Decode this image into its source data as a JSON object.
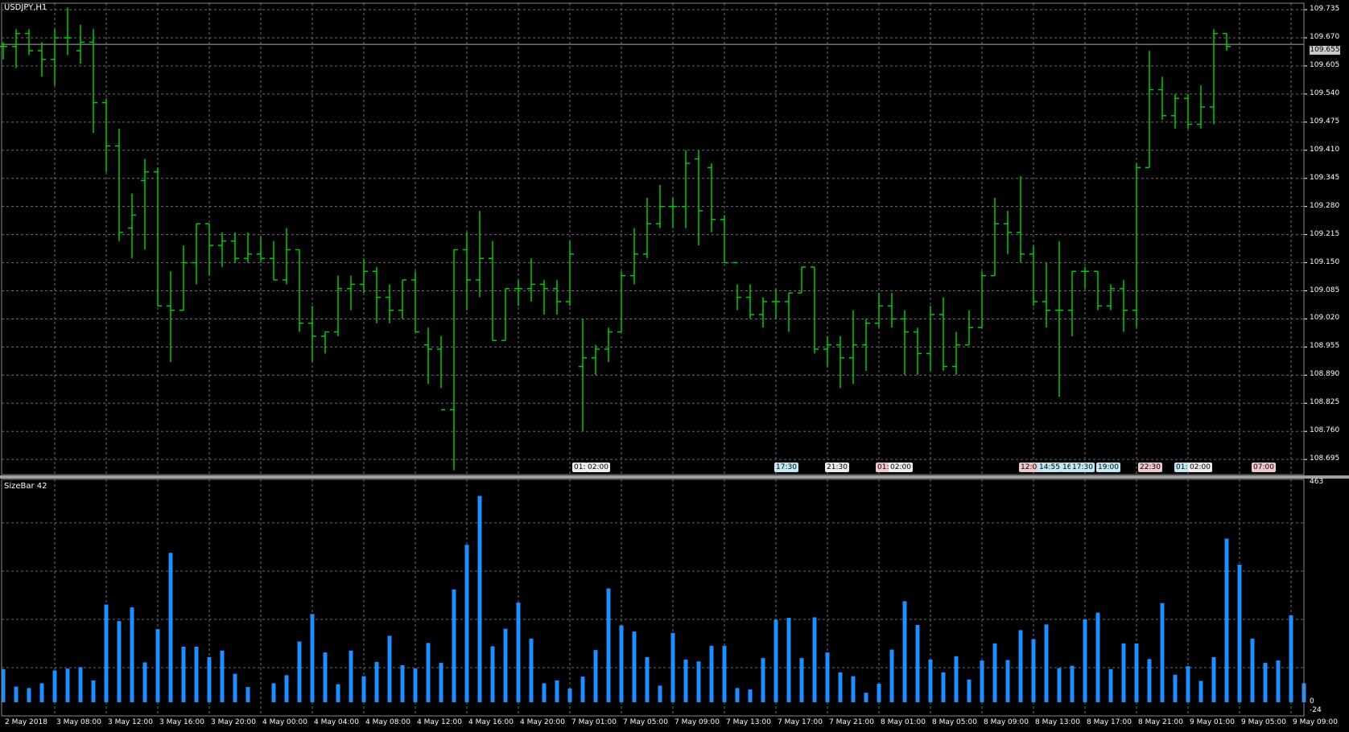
{
  "main_title": "USDJPY,H1",
  "sub_title": "SizeBar 42",
  "current_price": "109.655",
  "colors": {
    "background": "#000000",
    "grid": "#6b6b6b",
    "bars": "#00cc00",
    "histogram": "#1e8fff",
    "separator": "#a0a0a0"
  },
  "price_axis": [
    "109.735",
    "109.670",
    "109.605",
    "109.540",
    "109.475",
    "109.410",
    "109.345",
    "109.280",
    "109.215",
    "109.150",
    "109.085",
    "109.020",
    "108.955",
    "108.890",
    "108.825",
    "108.760",
    "108.695"
  ],
  "sub_axis": {
    "top": "463",
    "zero": "0",
    "bottom": "-24"
  },
  "time_labels": [
    "2 May 2018",
    "3 May 08:00",
    "3 May 12:00",
    "3 May 16:00",
    "3 May 20:00",
    "4 May 00:00",
    "4 May 04:00",
    "4 May 08:00",
    "4 May 12:00",
    "4 May 16:00",
    "4 May 20:00",
    "7 May 01:00",
    "7 May 05:00",
    "7 May 09:00",
    "7 May 13:00",
    "7 May 17:00",
    "7 May 21:00",
    "8 May 01:00",
    "8 May 05:00",
    "8 May 09:00",
    "8 May 13:00",
    "8 May 17:00",
    "8 May 21:00",
    "9 May 01:00",
    "9 May 05:00",
    "9 May 09:00"
  ],
  "events": [
    {
      "text": "01:",
      "color": "w"
    },
    {
      "text": "02:00",
      "color": "w"
    },
    {
      "text": "17:30",
      "color": "c"
    },
    {
      "text": "21:30",
      "color": "w"
    },
    {
      "text": "01:",
      "color": "r"
    },
    {
      "text": "02:00",
      "color": "w"
    },
    {
      "text": "12:00",
      "color": "r"
    },
    {
      "text": "14:55",
      "color": "c"
    },
    {
      "text": "16:",
      "color": "c"
    },
    {
      "text": "17:30",
      "color": "c"
    },
    {
      "text": "19:00",
      "color": "c"
    },
    {
      "text": "22:30",
      "color": "r"
    },
    {
      "text": "01:",
      "color": "c"
    },
    {
      "text": "02:00",
      "color": "w"
    },
    {
      "text": "07:00",
      "color": "r"
    }
  ],
  "chart_data": {
    "type": "ohlc",
    "symbol": "USDJPY",
    "timeframe": "H1",
    "ylim": [
      108.66,
      109.75
    ],
    "ohlc": [
      [
        109.65,
        109.66,
        109.62,
        109.65
      ],
      [
        109.65,
        109.69,
        109.6,
        109.68
      ],
      [
        109.68,
        109.69,
        109.63,
        109.64
      ],
      [
        109.64,
        109.66,
        109.58,
        109.62
      ],
      [
        109.62,
        109.69,
        109.56,
        109.67
      ],
      [
        109.67,
        109.74,
        109.63,
        109.67
      ],
      [
        109.64,
        109.7,
        109.61,
        109.66
      ],
      [
        109.66,
        109.69,
        109.45,
        109.52
      ],
      [
        109.52,
        109.53,
        109.36,
        109.42
      ],
      [
        109.42,
        109.46,
        109.2,
        109.22
      ],
      [
        109.23,
        109.31,
        109.16,
        109.26
      ],
      [
        109.34,
        109.39,
        109.18,
        109.36
      ],
      [
        109.36,
        109.37,
        109.05,
        109.05
      ],
      [
        109.05,
        109.13,
        108.92,
        109.04
      ],
      [
        109.04,
        109.19,
        109.04,
        109.15
      ],
      [
        109.15,
        109.24,
        109.1,
        109.24
      ],
      [
        109.24,
        109.24,
        109.12,
        109.19
      ],
      [
        109.19,
        109.22,
        109.14,
        109.2
      ],
      [
        109.2,
        109.22,
        109.15,
        109.16
      ],
      [
        109.16,
        109.22,
        109.15,
        109.17
      ],
      [
        109.17,
        109.21,
        109.15,
        109.16
      ],
      [
        109.16,
        109.2,
        109.11,
        109.11
      ],
      [
        109.11,
        109.23,
        109.1,
        109.18
      ],
      [
        109.18,
        109.18,
        108.99,
        109.01
      ],
      [
        109.01,
        109.05,
        108.92,
        108.98
      ],
      [
        108.98,
        108.99,
        108.94,
        108.99
      ],
      [
        108.99,
        109.12,
        108.98,
        109.09
      ],
      [
        109.09,
        109.12,
        109.04,
        109.1
      ],
      [
        109.1,
        109.16,
        109.08,
        109.13
      ],
      [
        109.13,
        109.14,
        109.01,
        109.07
      ],
      [
        109.07,
        109.1,
        109.01,
        109.04
      ],
      [
        109.04,
        109.11,
        109.02,
        109.11
      ],
      [
        109.11,
        109.13,
        108.99,
        108.99
      ],
      [
        108.96,
        109.0,
        108.87,
        108.95
      ],
      [
        108.95,
        108.98,
        108.86,
        108.81
      ],
      [
        108.81,
        109.18,
        108.67,
        109.18
      ],
      [
        109.18,
        109.22,
        109.04,
        109.11
      ],
      [
        109.11,
        109.27,
        109.07,
        109.16
      ],
      [
        109.16,
        109.2,
        108.97,
        108.97
      ],
      [
        108.97,
        109.09,
        108.97,
        109.09
      ],
      [
        109.09,
        109.11,
        109.05,
        109.09
      ],
      [
        109.09,
        109.16,
        109.06,
        109.1
      ],
      [
        109.1,
        109.11,
        109.03,
        109.09
      ],
      [
        109.09,
        109.11,
        109.03,
        109.06
      ],
      [
        109.06,
        109.2,
        109.05,
        109.17
      ],
      [
        108.91,
        109.02,
        108.76,
        108.93
      ],
      [
        108.93,
        108.96,
        108.89,
        108.95
      ],
      [
        108.95,
        109.0,
        108.92,
        108.99
      ],
      [
        108.99,
        109.13,
        108.99,
        109.12
      ],
      [
        109.12,
        109.23,
        109.1,
        109.17
      ],
      [
        109.17,
        109.3,
        109.16,
        109.24
      ],
      [
        109.24,
        109.33,
        109.23,
        109.28
      ],
      [
        109.28,
        109.3,
        109.23,
        109.28
      ],
      [
        109.28,
        109.41,
        109.23,
        109.38
      ],
      [
        109.39,
        109.41,
        109.19,
        109.27
      ],
      [
        109.37,
        109.38,
        109.22,
        109.25
      ],
      [
        109.25,
        109.26,
        109.15,
        109.15
      ],
      [
        109.15,
        109.1,
        109.04,
        109.07
      ],
      [
        109.07,
        109.1,
        109.02,
        109.03
      ],
      [
        109.03,
        109.07,
        109.0,
        109.06
      ],
      [
        109.06,
        109.09,
        109.02,
        109.06
      ],
      [
        109.06,
        109.08,
        108.99,
        109.08
      ],
      [
        109.08,
        109.14,
        109.08,
        109.14
      ],
      [
        109.14,
        109.14,
        108.94,
        108.95
      ],
      [
        108.95,
        108.98,
        108.91,
        108.96
      ],
      [
        108.96,
        108.98,
        108.86,
        108.93
      ],
      [
        108.93,
        109.04,
        108.87,
        108.96
      ],
      [
        108.96,
        109.02,
        108.9,
        109.01
      ],
      [
        109.01,
        109.08,
        109.0,
        109.05
      ],
      [
        109.05,
        109.08,
        109.0,
        109.02
      ],
      [
        109.02,
        109.04,
        108.89,
        108.99
      ],
      [
        108.99,
        109.0,
        108.89,
        108.94
      ],
      [
        108.94,
        109.05,
        108.9,
        109.03
      ],
      [
        109.03,
        109.07,
        108.9,
        108.91
      ],
      [
        108.91,
        108.99,
        108.89,
        108.96
      ],
      [
        108.96,
        109.04,
        108.96,
        109.0
      ],
      [
        109.0,
        109.13,
        109.0,
        109.12
      ],
      [
        109.12,
        109.3,
        109.12,
        109.24
      ],
      [
        109.24,
        109.27,
        109.17,
        109.22
      ],
      [
        109.22,
        109.35,
        109.15,
        109.17
      ],
      [
        109.17,
        109.19,
        109.05,
        109.06
      ],
      [
        109.06,
        109.15,
        109.0,
        109.04
      ],
      [
        109.04,
        109.2,
        108.84,
        109.04
      ],
      [
        109.04,
        109.13,
        108.98,
        109.13
      ],
      [
        109.13,
        109.14,
        109.09,
        109.13
      ],
      [
        109.13,
        109.13,
        109.04,
        109.05
      ],
      [
        109.05,
        109.1,
        109.04,
        109.09
      ],
      [
        109.09,
        109.11,
        108.99,
        109.04
      ],
      [
        109.04,
        109.38,
        109.0,
        109.37
      ],
      [
        109.37,
        109.64,
        109.37,
        109.55
      ],
      [
        109.55,
        109.58,
        109.48,
        109.49
      ],
      [
        109.49,
        109.54,
        109.46,
        109.53
      ],
      [
        109.53,
        109.54,
        109.46,
        109.47
      ],
      [
        109.47,
        109.56,
        109.46,
        109.51
      ],
      [
        109.51,
        109.69,
        109.47,
        109.68
      ],
      [
        109.68,
        109.68,
        109.64,
        109.65
      ]
    ],
    "size_bar": {
      "name": "SizeBar 42",
      "ylim": [
        -24,
        463
      ],
      "values": [
        70,
        33,
        30,
        40,
        67,
        71,
        74,
        46,
        206,
        171,
        200,
        84,
        154,
        315,
        117,
        117,
        95,
        109,
        60,
        32,
        0,
        40,
        57,
        128,
        186,
        105,
        38,
        109,
        55,
        85,
        140,
        78,
        71,
        125,
        83,
        238,
        332,
        435,
        118,
        155,
        210,
        134,
        40,
        46,
        29,
        54,
        110,
        240,
        162,
        149,
        95,
        35,
        146,
        90,
        86,
        119,
        119,
        30,
        27,
        93,
        174,
        178,
        93,
        179,
        105,
        63,
        55,
        20,
        39,
        111,
        213,
        163,
        90,
        63,
        97,
        48,
        88,
        124,
        89,
        152,
        133,
        164,
        72,
        77,
        175,
        189,
        70,
        124,
        124,
        91,
        209,
        58,
        76,
        45,
        95,
        345,
        290,
        134,
        83,
        88,
        183,
        40
      ]
    }
  }
}
